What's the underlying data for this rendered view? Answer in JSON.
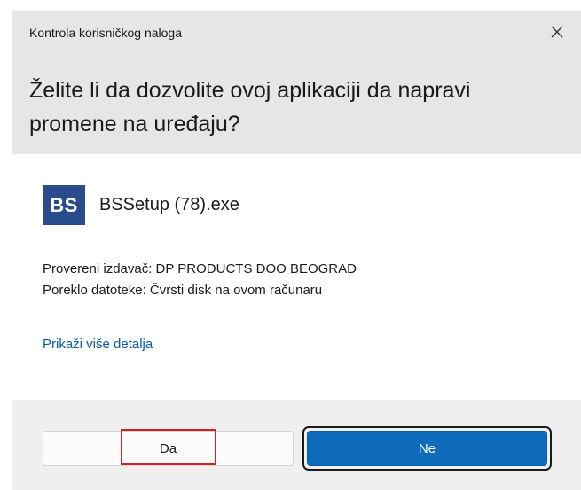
{
  "dialog": {
    "window_title": "Kontrola korisničkog naloga",
    "question": "Želite li da dozvolite ovoj aplikaciji da napravi promene na uređaju?",
    "close_icon": "close-icon"
  },
  "app": {
    "logo_text": "BS",
    "logo_color": "#2a4c8c",
    "name": "BSSetup (78).exe"
  },
  "info": {
    "publisher": "Provereni izdavač: DP PRODUCTS DOO BEOGRAD",
    "origin": "Poreklo datoteke: Čvrsti disk na ovom računaru"
  },
  "details_link": "Prikaži više detalja",
  "buttons": {
    "yes_label": "Da",
    "no_label": "Ne",
    "primary_color": "#0f6cbd",
    "highlight_color": "#d21f26"
  }
}
